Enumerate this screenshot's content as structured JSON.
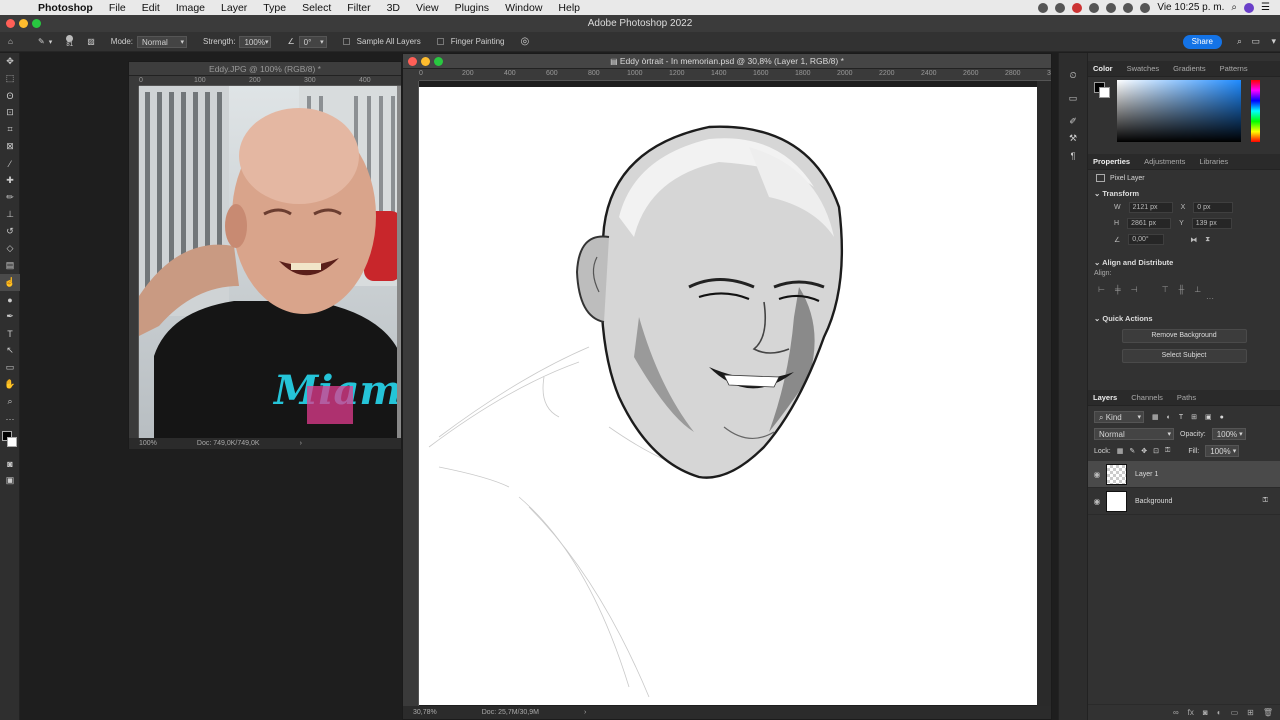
{
  "menubar": {
    "items": [
      "Photoshop",
      "File",
      "Edit",
      "Image",
      "Layer",
      "Type",
      "Select",
      "Filter",
      "3D",
      "View",
      "Plugins",
      "Window",
      "Help"
    ],
    "clock": "Vie 10:25 p. m."
  },
  "window": {
    "title": "Adobe Photoshop 2022"
  },
  "options": {
    "brush_size": "81",
    "mode_label": "Mode:",
    "mode_value": "Normal",
    "strength_label": "Strength:",
    "strength_value": "100%",
    "angle_value": "0°",
    "sample_all_layers": "Sample All Layers",
    "finger_painting": "Finger Painting",
    "share_label": "Share"
  },
  "docs": {
    "reference": {
      "title": "Eddy.JPG @ 100% (RGB/8) *",
      "ruler_ticks": [
        "0",
        "100",
        "200",
        "300",
        "400"
      ],
      "zoom": "100%",
      "doc_size": "Doc: 749,0K/749,0K"
    },
    "main": {
      "title": "Eddy òrtrait - In memorian.psd @ 30,8% (Layer 1, RGB/8) *",
      "ruler_ticks": [
        "0",
        "200",
        "400",
        "600",
        "800",
        "1000",
        "1200",
        "1400",
        "1600",
        "1800",
        "2000",
        "2200",
        "2400",
        "2600",
        "2800",
        "3"
      ],
      "zoom": "30,78%",
      "doc_size": "Doc: 25,7M/30,9M"
    }
  },
  "panels": {
    "color_tabs": [
      "Color",
      "Swatches",
      "Gradients",
      "Patterns"
    ],
    "props_tabs": [
      "Properties",
      "Adjustments",
      "Libraries"
    ],
    "pixel_layer": "Pixel Layer",
    "transform": {
      "title": "Transform",
      "w": "2121 px",
      "x": "0 px",
      "h": "2861 px",
      "y": "139 px",
      "angle": "0,00°",
      "w_label": "W",
      "h_label": "H",
      "x_label": "X",
      "y_label": "Y"
    },
    "align": {
      "title": "Align and Distribute",
      "align_label": "Align:"
    },
    "quick_actions": {
      "title": "Quick Actions",
      "remove_bg": "Remove Background",
      "select_subject": "Select Subject"
    },
    "layers_tabs": [
      "Layers",
      "Channels",
      "Paths"
    ],
    "layers": {
      "kind": "Kind",
      "blend_mode": "Normal",
      "opacity_label": "Opacity:",
      "opacity": "100%",
      "lock_label": "Lock:",
      "fill_label": "Fill:",
      "fill": "100%",
      "items": [
        "Layer 1",
        "Background"
      ]
    }
  },
  "colors": {
    "accent": "#1473e6",
    "canvas": "#ffffff",
    "workspace": "#1e1e1e"
  }
}
